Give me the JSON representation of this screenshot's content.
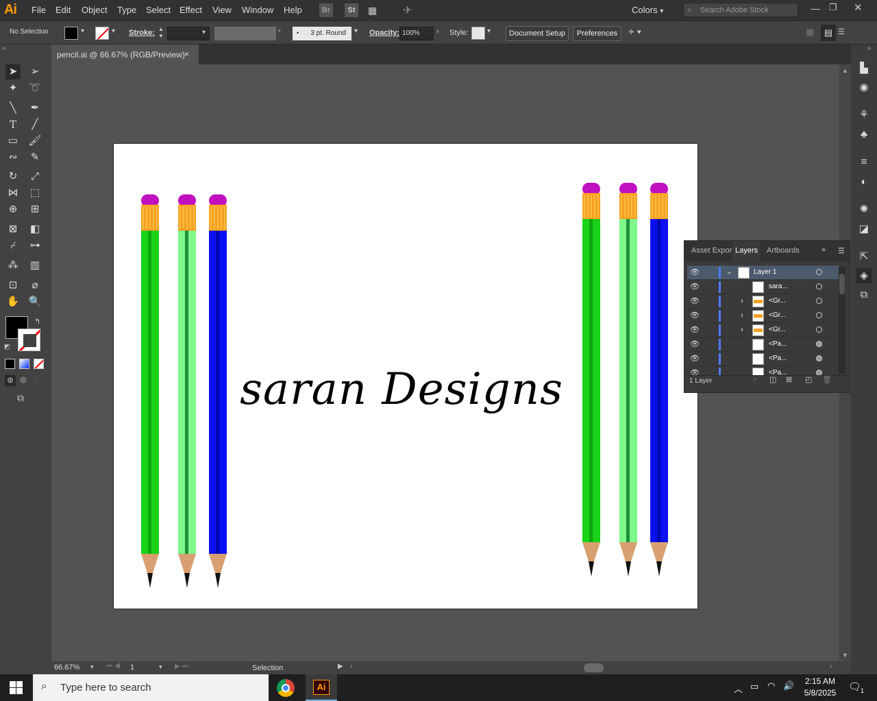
{
  "app": {
    "logo": "Ai"
  },
  "menu": [
    "File",
    "Edit",
    "Object",
    "Type",
    "Select",
    "Effect",
    "View",
    "Window",
    "Help"
  ],
  "menubar_right": {
    "br": "Br",
    "st": "St",
    "workspace": "Colors",
    "search_placeholder": "Search Adobe Stock"
  },
  "control": {
    "selection": "No Selection",
    "stroke_label": "Stroke:",
    "brush": "3 pt. Round",
    "opacity_label": "Opacity:",
    "opacity_value": "100%",
    "style_label": "Style:",
    "doc_setup": "Document Setup",
    "preferences": "Preferences"
  },
  "tab": {
    "title": "pencil.ai @ 66.67% (RGB/Preview)",
    "close": "×"
  },
  "artwork": {
    "text": "saran Designs"
  },
  "pencils_left": [
    {
      "body": "#18d318",
      "stripe": "#0ea50e"
    },
    {
      "body": "#7ef88a",
      "stripe": "#1e8f3a"
    },
    {
      "body": "#0a10f0",
      "stripe": "#0008b0"
    }
  ],
  "pencils_right": [
    {
      "body": "#18d318",
      "stripe": "#0ea50e"
    },
    {
      "body": "#7ef88a",
      "stripe": "#1e8f3a"
    },
    {
      "body": "#0a10f0",
      "stripe": "#0008b0"
    }
  ],
  "colors": {
    "eraser": "#c010c0",
    "ferrule": "#f8a020",
    "wood": "#d8a070"
  },
  "layers_panel": {
    "tabs": [
      "Asset Expor",
      "Layers",
      "Artboards"
    ],
    "rows": [
      "Layer 1",
      "sara...",
      "<Gr...",
      "<Gr...",
      "<Gr...",
      "<Pa...",
      "<Pa...",
      "<Pa..."
    ],
    "footer": "1 Layer"
  },
  "status": {
    "zoom": "66.67%",
    "artboard": "1",
    "tool": "Selection"
  },
  "taskbar": {
    "search": "Type here to search",
    "time": "2:15 AM",
    "date": "5/8/2025",
    "notif": "1"
  }
}
